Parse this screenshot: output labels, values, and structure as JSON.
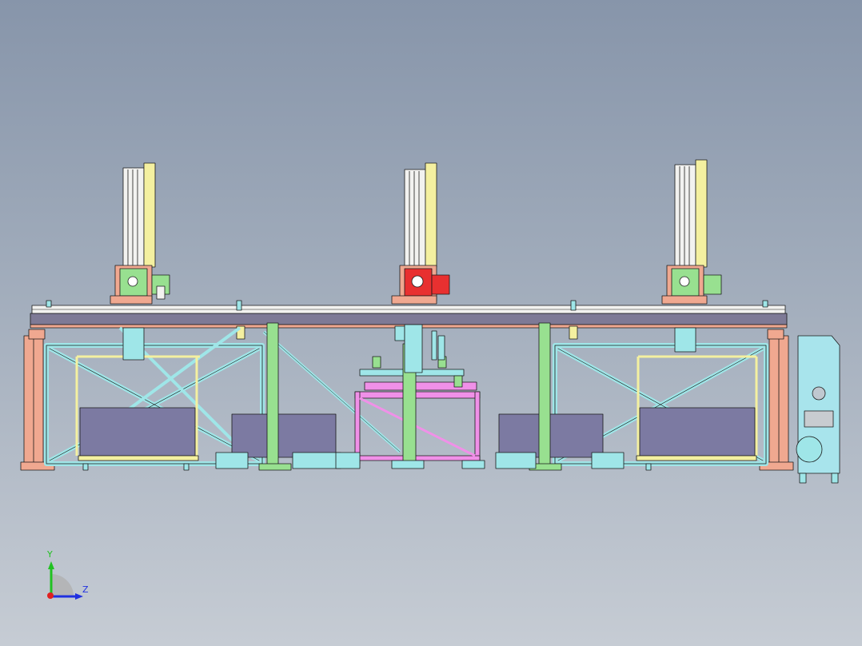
{
  "viewport": {
    "background_top": "#8795aa",
    "background_bottom": "#c6ccd4"
  },
  "triad": {
    "y_label": "Y",
    "z_label": "Z",
    "y_color": "#21c121",
    "z_color": "#2030e0",
    "x_color": "#e02020"
  },
  "machine": {
    "beam_color": "#7e7a96",
    "rail_color": "#f2f2f0",
    "salmon": "#f0a890",
    "cyan": "#9fe6e8",
    "green": "#98e090",
    "yellow": "#f4f0a0",
    "magenta": "#f090e8",
    "purple_block": "#7c7aa2",
    "red_carriage": "#e83030",
    "cabinet": "#a8e4ec"
  }
}
